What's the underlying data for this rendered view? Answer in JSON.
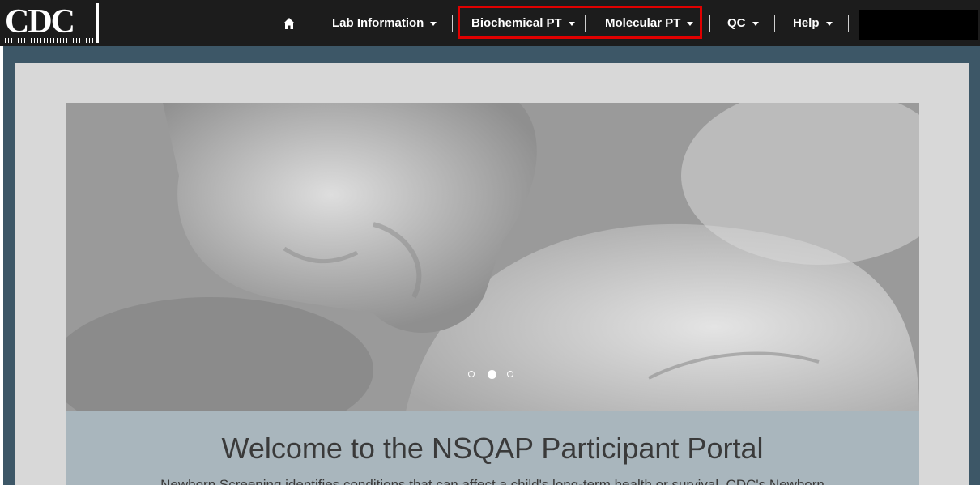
{
  "logo": {
    "text": "CDC"
  },
  "nav": {
    "home_icon": "home-icon",
    "items": [
      {
        "label": "Lab Information"
      },
      {
        "label": "Biochemical PT"
      },
      {
        "label": "Molecular PT"
      },
      {
        "label": "QC"
      },
      {
        "label": "Help"
      }
    ],
    "highlight_color": "#e00000"
  },
  "carousel": {
    "slide_count": 3,
    "active_index": 1
  },
  "caption": {
    "title": "Welcome to the NSQAP Participant Portal",
    "intro": "Newborn Screening identifies conditions that can affect a child's long-term health or survival. CDC's Newborn"
  },
  "colors": {
    "topbar": "#1c1c1c",
    "frame": "#3d5767",
    "panel": "#d8d8d8",
    "caption_bg": "#a9b6bd"
  }
}
